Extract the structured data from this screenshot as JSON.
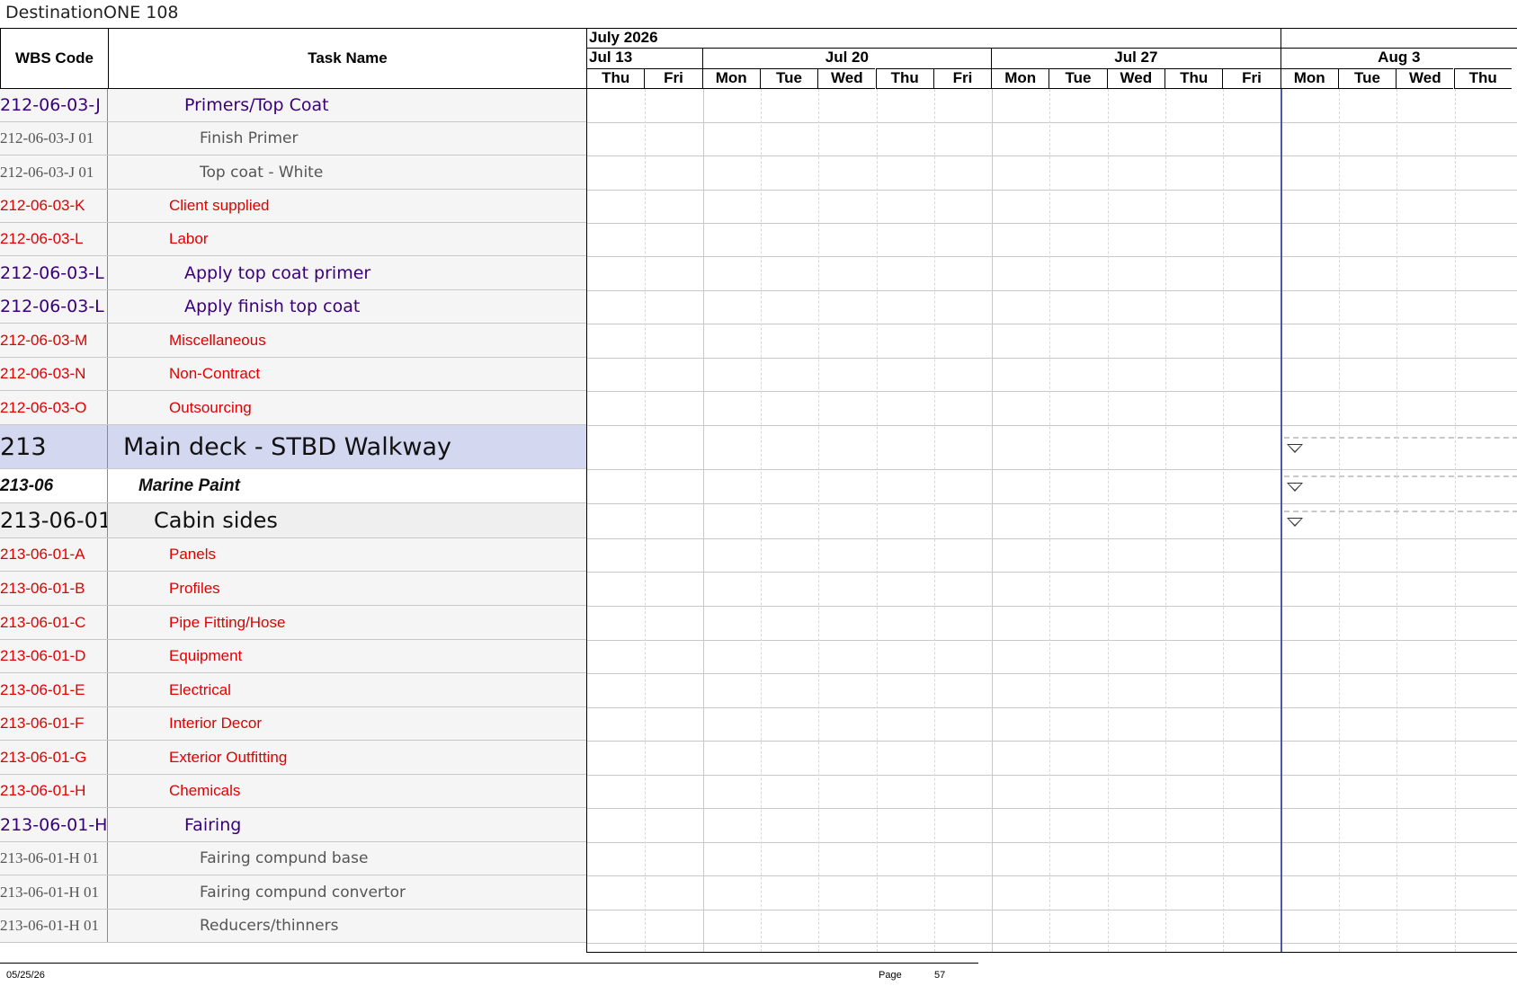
{
  "page_title": "DestinationONE 108",
  "headers": {
    "wbs": "WBS Code",
    "task": "Task Name"
  },
  "timeline": {
    "month": "July 2026",
    "weeks": [
      "Jul 13",
      "Jul 20",
      "Jul 27",
      "Aug 3"
    ],
    "days": [
      "Thu",
      "Fri",
      "Mon",
      "Tue",
      "Wed",
      "Thu",
      "Fri",
      "Mon",
      "Tue",
      "Wed",
      "Thu",
      "Fri",
      "Mon",
      "Tue",
      "Wed",
      "Thu"
    ]
  },
  "rows": [
    {
      "wbs": "212-06-03-J (",
      "task": "Primers/Top Coat",
      "style": "purple"
    },
    {
      "wbs": "212-06-03-J 01",
      "task": "Finish Primer",
      "style": "gray"
    },
    {
      "wbs": "212-06-03-J 01",
      "task": "Top coat - White",
      "style": "gray"
    },
    {
      "wbs": "212-06-03-K",
      "task": "Client supplied",
      "style": "red"
    },
    {
      "wbs": "212-06-03-L",
      "task": "Labor",
      "style": "red"
    },
    {
      "wbs": "212-06-03-L (",
      "task": "Apply top coat primer",
      "style": "purple"
    },
    {
      "wbs": "212-06-03-L (",
      "task": "Apply finish top coat",
      "style": "purple"
    },
    {
      "wbs": "212-06-03-M",
      "task": "Miscellaneous",
      "style": "red"
    },
    {
      "wbs": "212-06-03-N",
      "task": "Non-Contract",
      "style": "red"
    },
    {
      "wbs": "212-06-03-O",
      "task": "Outsourcing",
      "style": "red"
    },
    {
      "wbs": "213",
      "task": "Main deck - STBD Walkway",
      "style": "level1"
    },
    {
      "wbs": "213-06",
      "task": "Marine Paint",
      "style": "level2"
    },
    {
      "wbs": "213-06-01",
      "task": "Cabin sides",
      "style": "level3"
    },
    {
      "wbs": "213-06-01-A",
      "task": "Panels",
      "style": "red"
    },
    {
      "wbs": "213-06-01-B",
      "task": "Profiles",
      "style": "red"
    },
    {
      "wbs": "213-06-01-C",
      "task": "Pipe Fitting/Hose",
      "style": "red"
    },
    {
      "wbs": "213-06-01-D",
      "task": "Equipment",
      "style": "red"
    },
    {
      "wbs": "213-06-01-E",
      "task": "Electrical",
      "style": "red"
    },
    {
      "wbs": "213-06-01-F",
      "task": "Interior Decor",
      "style": "red"
    },
    {
      "wbs": "213-06-01-G",
      "task": "Exterior Outfitting",
      "style": "red"
    },
    {
      "wbs": "213-06-01-H",
      "task": "Chemicals",
      "style": "red"
    },
    {
      "wbs": "213-06-01-H (",
      "task": "Fairing",
      "style": "purple"
    },
    {
      "wbs": "213-06-01-H 01",
      "task": "Fairing compund base",
      "style": "gray"
    },
    {
      "wbs": "213-06-01-H 01",
      "task": "Fairing compund convertor",
      "style": "gray"
    },
    {
      "wbs": "213-06-01-H 01",
      "task": "Reducers/thinners",
      "style": "gray"
    }
  ],
  "footer": {
    "date": "05/25/26",
    "page_label": "Page",
    "page_number": "57"
  },
  "colors": {
    "red": "#e00000",
    "purple": "#3a007a",
    "gray": "#555555",
    "summary_band": "#d3d7ef",
    "today_line": "#4a5aa8"
  }
}
